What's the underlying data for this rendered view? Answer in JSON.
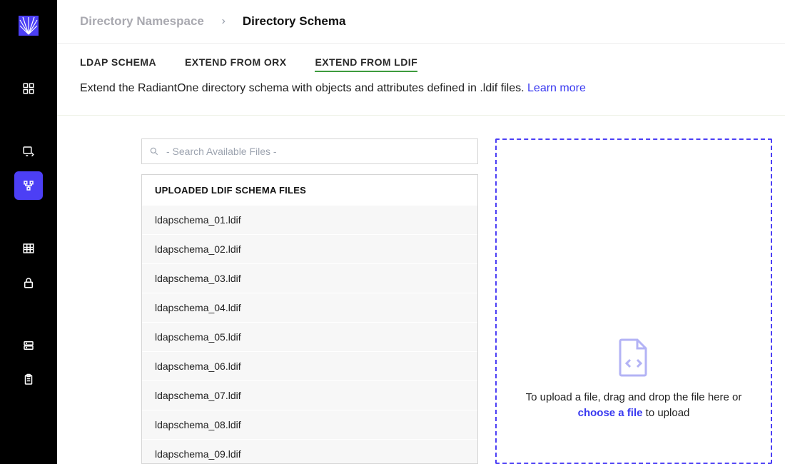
{
  "breadcrumb": {
    "parent": "Directory Namespace",
    "current": "Directory Schema"
  },
  "tabs": [
    {
      "id": "ldap-schema",
      "label": "LDAP SCHEMA",
      "active": false
    },
    {
      "id": "extend-orx",
      "label": "EXTEND FROM ORX",
      "active": false
    },
    {
      "id": "extend-ldif",
      "label": "EXTEND FROM LDIF",
      "active": true
    }
  ],
  "description": {
    "text": "Extend the RadiantOne directory schema with objects and attributes defined in .ldif files. ",
    "learn_more": "Learn more"
  },
  "search": {
    "placeholder": "- Search Available Files -",
    "value": ""
  },
  "file_list": {
    "header": "UPLOADED LDIF SCHEMA FILES",
    "items": [
      "ldapschema_01.ldif",
      "ldapschema_02.ldif",
      "ldapschema_03.ldif",
      "ldapschema_04.ldif",
      "ldapschema_05.ldif",
      "ldapschema_06.ldif",
      "ldapschema_07.ldif",
      "ldapschema_08.ldif",
      "ldapschema_09.ldif"
    ]
  },
  "dropzone": {
    "prefix": "To upload a file, drag and drop the file here or ",
    "choose": "choose a file",
    "suffix": " to upload"
  },
  "sidebar_icons": [
    "dashboard-icon",
    "server-code-icon",
    "hierarchy-icon",
    "table-icon",
    "lock-icon",
    "storage-icon",
    "clipboard-icon"
  ]
}
